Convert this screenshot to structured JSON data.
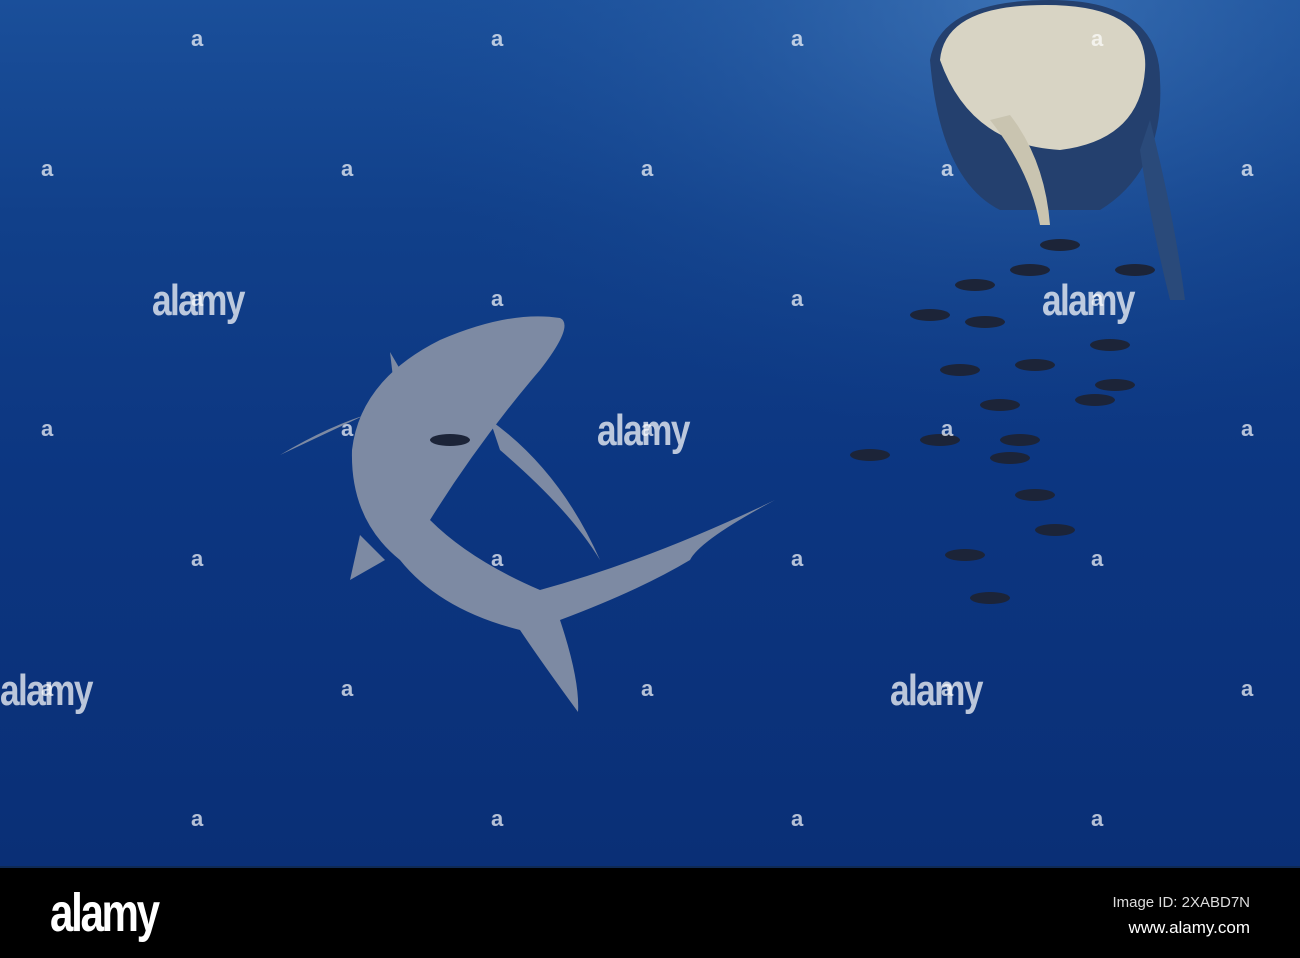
{
  "watermark": {
    "text": "alamy",
    "mini": "a"
  },
  "footer": {
    "logo": "alamy",
    "image_id": "Image ID: 2XABD7N",
    "website": "www.alamy.com"
  },
  "colors": {
    "water_top": "#1a4f9a",
    "water_bottom": "#0a2f76",
    "shark": "#7d8aa3"
  }
}
